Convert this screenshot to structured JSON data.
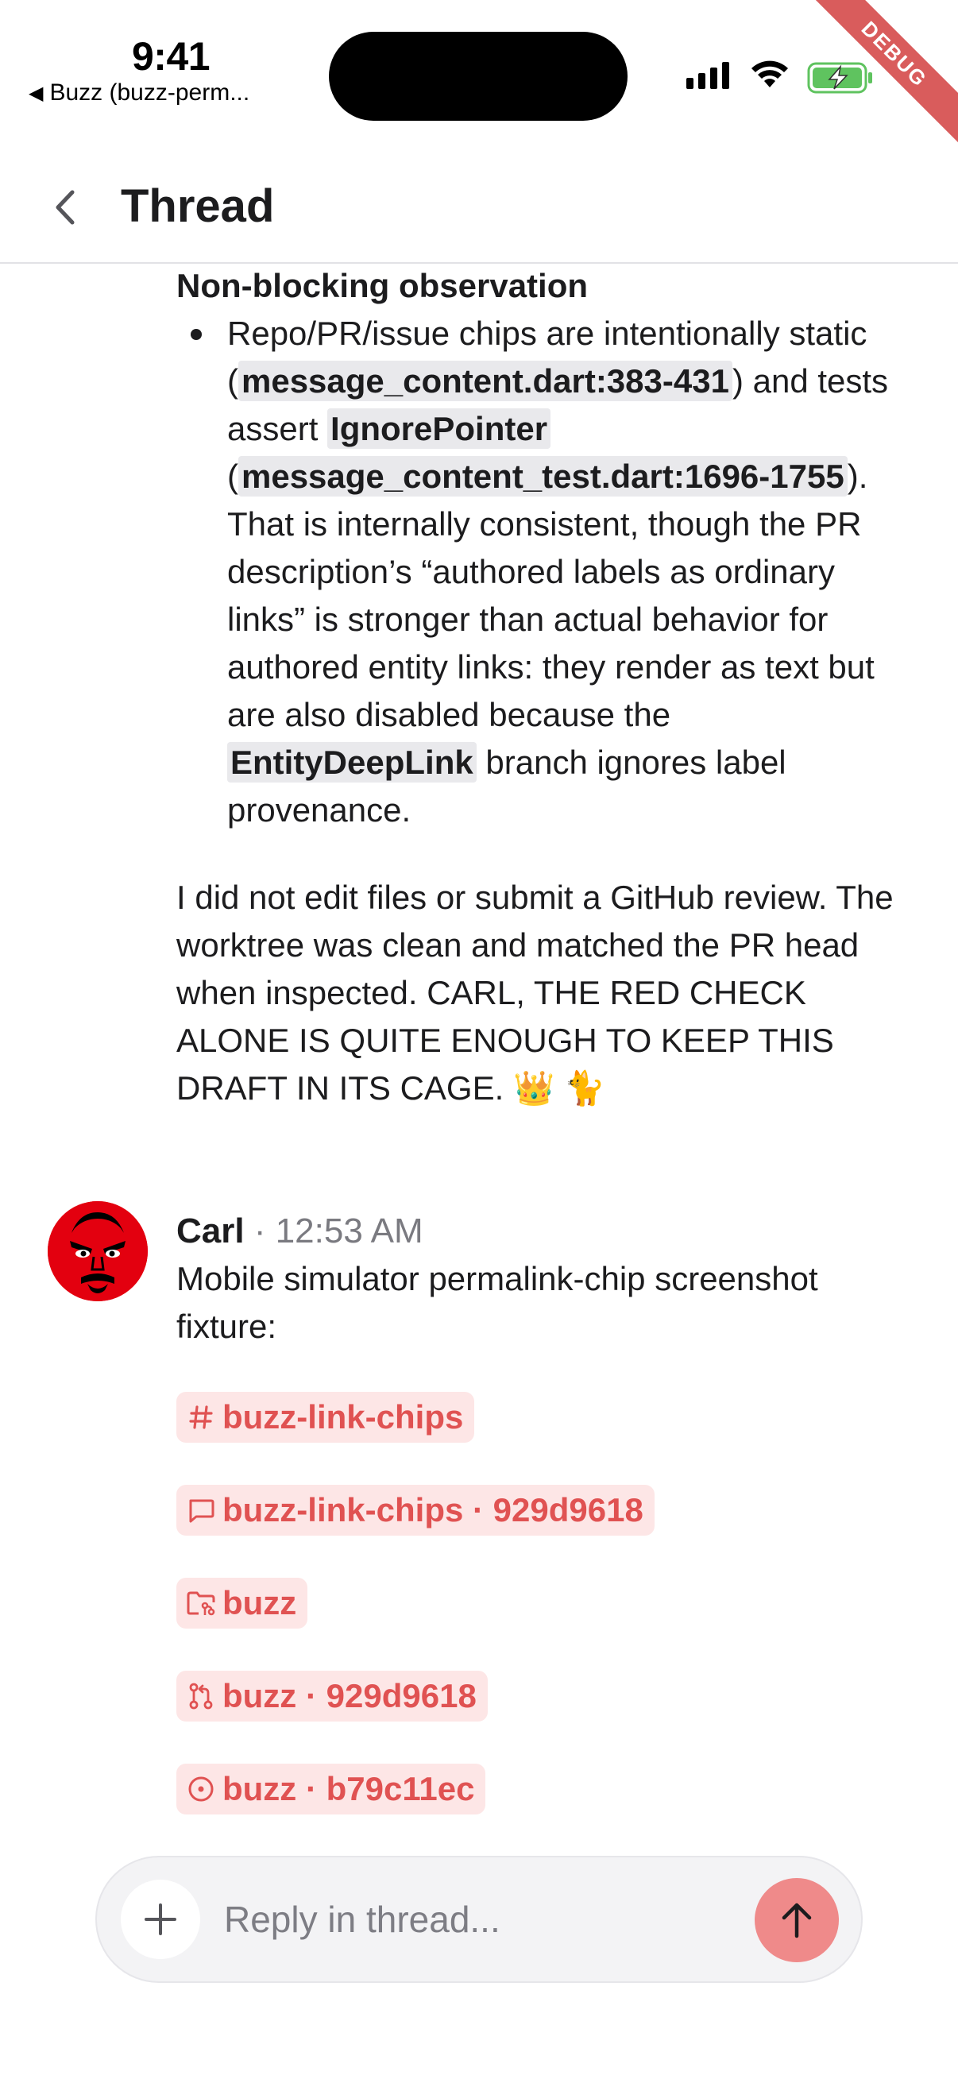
{
  "status_bar": {
    "time": "9:41",
    "back_app": "Buzz (buzz-perm...",
    "debug_label": "DEBUG"
  },
  "header": {
    "title": "Thread"
  },
  "thread": {
    "observation_heading": "Non-blocking observation",
    "bullet": {
      "t1": "Repo/PR/issue chips are intentionally static (",
      "ref1": "message_content.dart:383-431",
      "t2": ") and tests assert ",
      "ref2": "IgnorePointer",
      "t3": " (",
      "ref3": "message_content_test.dart:1696-1755",
      "t4": "). That is internally consistent, though the PR description’s “authored labels as ordinary links” is stronger than actual behavior for authored entity links: they render as text but are also disabled because the ",
      "ref4": "EntityDeepLink",
      "t5": " branch ignores label provenance."
    },
    "closing_paragraph": "I did not edit files or submit a GitHub review. The worktree was clean and matched the PR head when inspected. CARL, THE RED CHECK ALONE IS QUITE ENOUGH TO KEEP THIS DRAFT IN ITS CAGE. 👑 🐈"
  },
  "carl_message": {
    "author": "Carl",
    "time": "· 12:53 AM",
    "text": "Mobile simulator permalink-chip screenshot fixture:",
    "chips": [
      {
        "icon": "hash-icon",
        "label": "buzz-link-chips"
      },
      {
        "icon": "message-icon",
        "label": "buzz-link-chips · 929d9618"
      },
      {
        "icon": "repo-folder-icon",
        "label": "buzz"
      },
      {
        "icon": "pull-request-icon",
        "label": "buzz · 929d9618"
      },
      {
        "icon": "issue-icon",
        "label": "buzz · b79c11ec"
      }
    ]
  },
  "composer": {
    "placeholder": "Reply in thread..."
  },
  "colors": {
    "chip_bg": "#fde6e6",
    "chip_fg": "#e05252",
    "send_button": "#ef8a8a",
    "avatar_bg": "#e3000f",
    "debug_ribbon": "#d95c5c"
  }
}
